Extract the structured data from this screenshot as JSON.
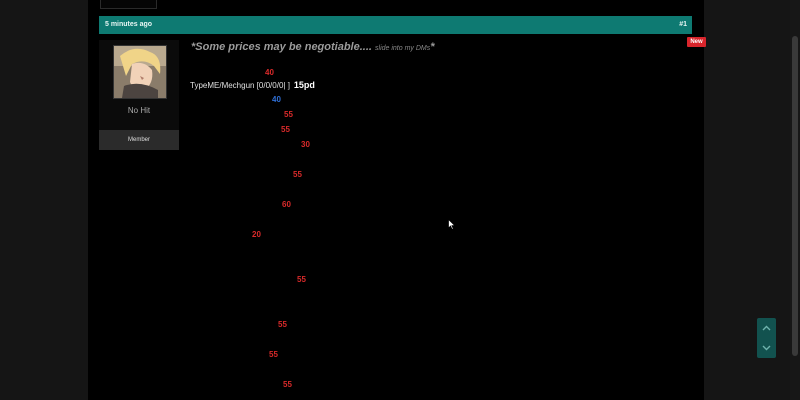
{
  "post": {
    "time": "5 minutes ago",
    "number": "#1",
    "new_badge": "New"
  },
  "user": {
    "name": "No Hit",
    "role": "Member"
  },
  "note": {
    "main": "*Some prices may be negotiable....",
    "small": "slide into my DMs",
    "end": "*"
  },
  "item": {
    "label": "TypeME/Mechgun [0/0/0/0|    ]",
    "price": "15pd"
  },
  "prices": [
    {
      "text": "40",
      "color": "#d92a2a"
    },
    {
      "text": "40",
      "color": "#2f6fd6"
    },
    {
      "text": "55",
      "color": "#d92a2a"
    },
    {
      "text": "55",
      "color": "#d92a2a"
    },
    {
      "text": "30",
      "color": "#d92a2a"
    },
    {
      "text": "55",
      "color": "#d92a2a"
    },
    {
      "text": "60",
      "color": "#d92a2a"
    },
    {
      "text": "20",
      "color": "#d92a2a"
    },
    {
      "text": "55",
      "color": "#d92a2a"
    },
    {
      "text": "55",
      "color": "#d92a2a"
    },
    {
      "text": "55",
      "color": "#d92a2a"
    },
    {
      "text": "55",
      "color": "#d92a2a"
    }
  ],
  "icons": {
    "scroll_up": "chevron-up-icon",
    "scroll_down": "chevron-down-icon"
  }
}
